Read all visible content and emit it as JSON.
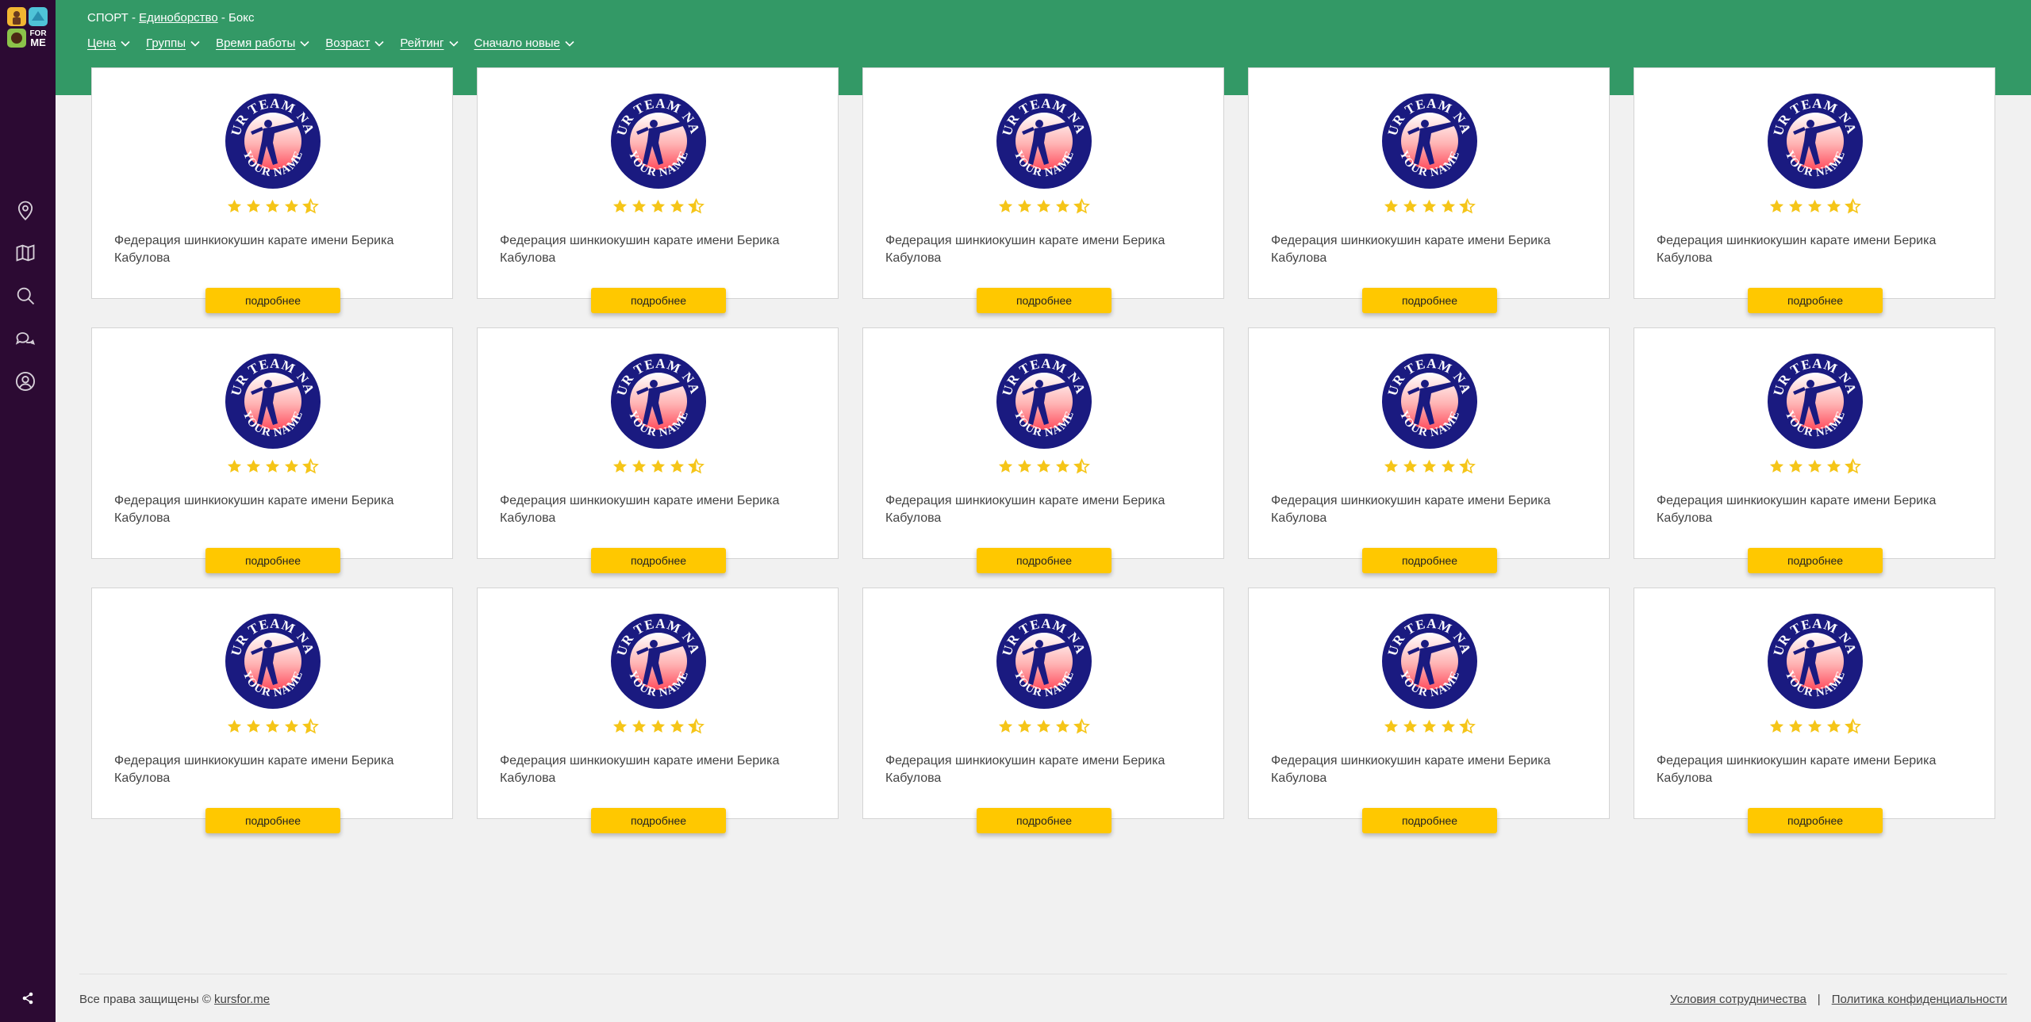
{
  "breadcrumb": {
    "part1": "СПОРТ",
    "sep1": " - ",
    "part2": "Единоборство",
    "sep2": " - ",
    "part3": "Бокс"
  },
  "filters": [
    {
      "label": "Цена"
    },
    {
      "label": "Группы"
    },
    {
      "label": "Время работы"
    },
    {
      "label": "Возраст"
    },
    {
      "label": "Рейтинг"
    },
    {
      "label": "Сначало новые"
    }
  ],
  "sidebar": {
    "icons": [
      "location-icon",
      "map-icon",
      "search-icon",
      "chat-icon",
      "user-icon"
    ],
    "share_icon": "share-icon"
  },
  "colors": {
    "sidebar": "#2c0a33",
    "header": "#339966",
    "button": "#ffc800",
    "star": "#f5c518"
  },
  "logo_text": {
    "top": "YOUR TEAM NAME",
    "bottom": "YOUR NAME",
    "brand": "FOR ME"
  },
  "cards": [
    {
      "title": "Федерация шинкиокушин карате имени Берика Кабулова",
      "rating": 4.5,
      "button": "подробнее"
    },
    {
      "title": "Федерация шинкиокушин карате имени Берика Кабулова",
      "rating": 4.5,
      "button": "подробнее"
    },
    {
      "title": "Федерация шинкиокушин карате имени Берика Кабулова",
      "rating": 4.5,
      "button": "подробнее"
    },
    {
      "title": "Федерация шинкиокушин карате имени Берика Кабулова",
      "rating": 4.5,
      "button": "подробнее"
    },
    {
      "title": "Федерация шинкиокушин карате имени Берика Кабулова",
      "rating": 4.5,
      "button": "подробнее"
    },
    {
      "title": "Федерация шинкиокушин карате имени Берика Кабулова",
      "rating": 4.5,
      "button": "подробнее"
    },
    {
      "title": "Федерация шинкиокушин карате имени Берика Кабулова",
      "rating": 4.5,
      "button": "подробнее"
    },
    {
      "title": "Федерация шинкиокушин карате имени Берика Кабулова",
      "rating": 4.5,
      "button": "подробнее"
    },
    {
      "title": "Федерация шинкиокушин карате имени Берика Кабулова",
      "rating": 4.5,
      "button": "подробнее"
    },
    {
      "title": "Федерация шинкиокушин карате имени Берика Кабулова",
      "rating": 4.5,
      "button": "подробнее"
    },
    {
      "title": "Федерация шинкиокушин карате имени Берика Кабулова",
      "rating": 4.5,
      "button": "подробнее"
    },
    {
      "title": "Федерация шинкиокушин карате имени Берика Кабулова",
      "rating": 4.5,
      "button": "подробнее"
    },
    {
      "title": "Федерация шинкиокушин карате имени Берика Кабулова",
      "rating": 4.5,
      "button": "подробнее"
    },
    {
      "title": "Федерация шинкиокушин карате имени Берика Кабулова",
      "rating": 4.5,
      "button": "подробнее"
    },
    {
      "title": "Федерация шинкиокушин карате имени Берика Кабулова",
      "rating": 4.5,
      "button": "подробнее"
    }
  ],
  "footer": {
    "copyright": "Все права защищены © ",
    "site_link": "kursfor.me",
    "terms": "Условия сотрудничества",
    "divider": "|",
    "privacy": "Политика конфиденциальности"
  }
}
